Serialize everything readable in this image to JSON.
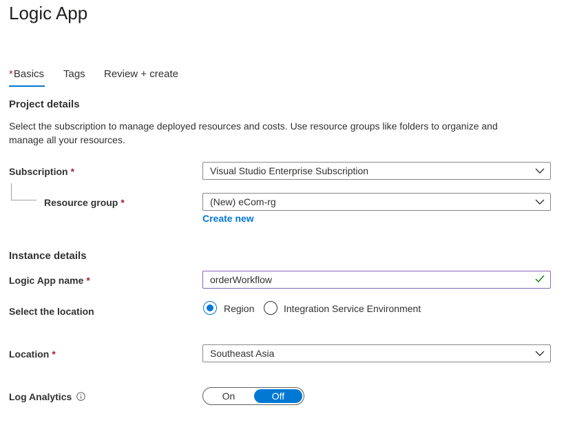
{
  "page": {
    "title": "Logic App"
  },
  "tabs": [
    {
      "label": "Basics",
      "required": "*",
      "active": true
    },
    {
      "label": "Tags"
    },
    {
      "label": "Review + create"
    }
  ],
  "project": {
    "heading": "Project details",
    "description": "Select the subscription to manage deployed resources and costs. Use resource groups like folders to organize and manage all your resources.",
    "subscription": {
      "label": "Subscription",
      "required": "*",
      "value": "Visual Studio Enterprise Subscription"
    },
    "resource_group": {
      "label": "Resource group",
      "required": "*",
      "value": "(New) eCom-rg",
      "create_new": "Create new"
    }
  },
  "instance": {
    "heading": "Instance details",
    "name": {
      "label": "Logic App name",
      "required": "*",
      "value": "orderWorkflow"
    },
    "location_type": {
      "label": "Select the location",
      "options": [
        {
          "label": "Region",
          "selected": true
        },
        {
          "label": "Integration Service Environment",
          "selected": false
        }
      ]
    },
    "location": {
      "label": "Location",
      "required": "*",
      "value": "Southeast Asia"
    },
    "log_analytics": {
      "label": "Log Analytics",
      "on": "On",
      "off": "Off",
      "state": "Off"
    }
  },
  "colors": {
    "accent": "#0078d4",
    "required": "#a4262c",
    "valid": "#107c10"
  },
  "icons": {
    "dropdown": "chevron-down-icon",
    "valid": "checkmark-icon",
    "info": "info-icon"
  }
}
